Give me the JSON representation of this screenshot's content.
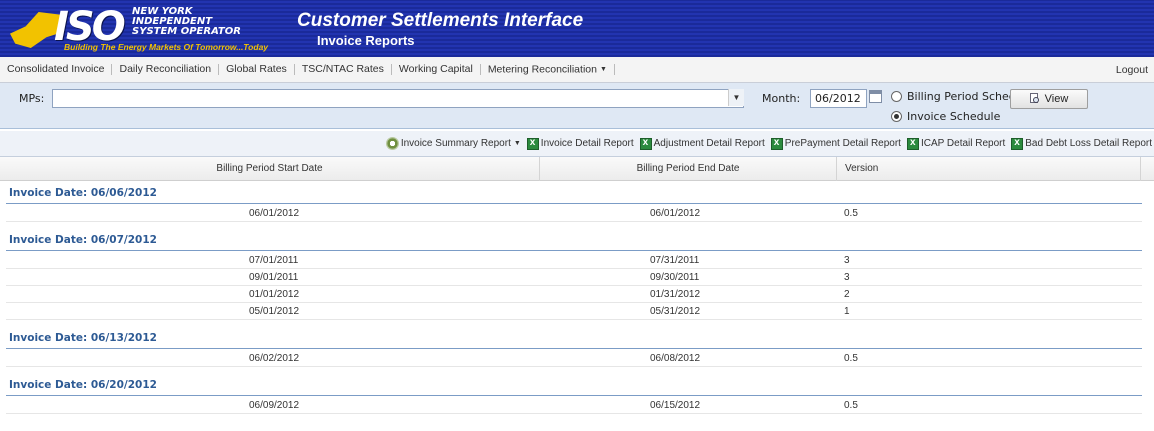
{
  "header": {
    "logo_text": "ISO",
    "org_lines": [
      "NEW YORK",
      "INDEPENDENT",
      "SYSTEM OPERATOR"
    ],
    "tagline": "Building The Energy Markets Of Tomorrow...Today",
    "title": "Customer Settlements Interface",
    "subtitle": "Invoice Reports",
    "banner_color": "#1a2a9a",
    "accent_color": "#f2c200"
  },
  "nav": {
    "items": [
      "Consolidated Invoice",
      "Daily Reconciliation",
      "Global Rates",
      "TSC/NTAC Rates",
      "Working Capital",
      "Metering Reconciliation"
    ],
    "logout": "Logout"
  },
  "filter": {
    "mps_label": "MPs:",
    "mps_value": "",
    "month_label": "Month:",
    "month_value": "06/2012",
    "radio_billing": "Billing Period Schedule",
    "radio_invoice": "Invoice Schedule",
    "selected_radio": "Invoice Schedule",
    "view_label": "View"
  },
  "toolbar": {
    "items": [
      "Invoice Summary Report",
      "Invoice Detail Report",
      "Adjustment Detail Report",
      "PrePayment Detail Report",
      "ICAP Detail Report",
      "Bad Debt Loss Detail Report"
    ]
  },
  "table": {
    "columns": [
      "Billing Period Start Date",
      "Billing Period End Date",
      "Version"
    ],
    "groups": [
      {
        "title": "Invoice Date: 06/06/2012",
        "rows": [
          [
            "06/01/2012",
            "06/01/2012",
            "0.5"
          ]
        ]
      },
      {
        "title": "Invoice Date: 06/07/2012",
        "rows": [
          [
            "07/01/2011",
            "07/31/2011",
            "3"
          ],
          [
            "09/01/2011",
            "09/30/2011",
            "3"
          ],
          [
            "01/01/2012",
            "01/31/2012",
            "2"
          ],
          [
            "05/01/2012",
            "05/31/2012",
            "1"
          ]
        ]
      },
      {
        "title": "Invoice Date: 06/13/2012",
        "rows": [
          [
            "06/02/2012",
            "06/08/2012",
            "0.5"
          ]
        ]
      },
      {
        "title": "Invoice Date: 06/20/2012",
        "rows": [
          [
            "06/09/2012",
            "06/15/2012",
            "0.5"
          ]
        ]
      }
    ]
  }
}
